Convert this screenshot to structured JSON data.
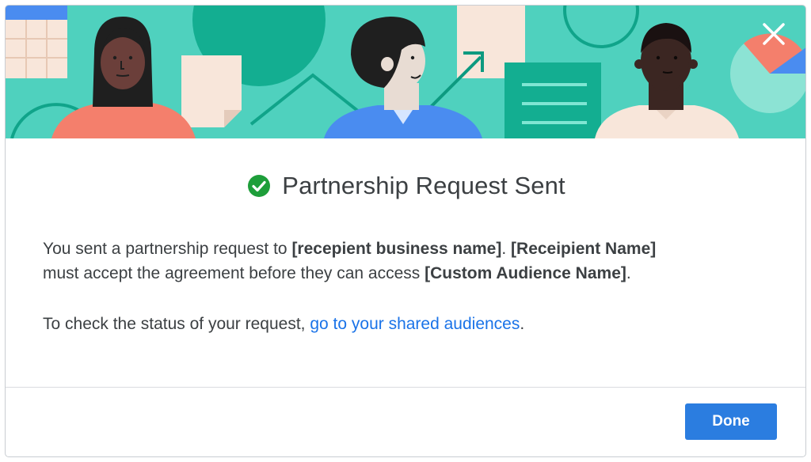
{
  "dialog": {
    "title": "Partnership Request Sent",
    "close_icon": "close-icon",
    "status_icon": "check-circle-icon",
    "message": {
      "part1": "You sent a partnership request to ",
      "business_name": "[recepient business name]",
      "part2": ". ",
      "recipient_name": "[Receipient Name]",
      "part3": " must accept the agreement before they can access ",
      "audience_name": "[Custom Audience Name]",
      "part4": "."
    },
    "status_check": {
      "prefix": "To check the status of your request, ",
      "link_text": "go to your shared audiences",
      "suffix": "."
    },
    "done_label": "Done"
  },
  "colors": {
    "banner_bg": "#4fd1be",
    "accent_dark_teal": "#0fae8e",
    "check_green": "#1e9e3a",
    "link_blue": "#1a73e8",
    "button_blue": "#2b7de0",
    "text": "#3c4043"
  }
}
